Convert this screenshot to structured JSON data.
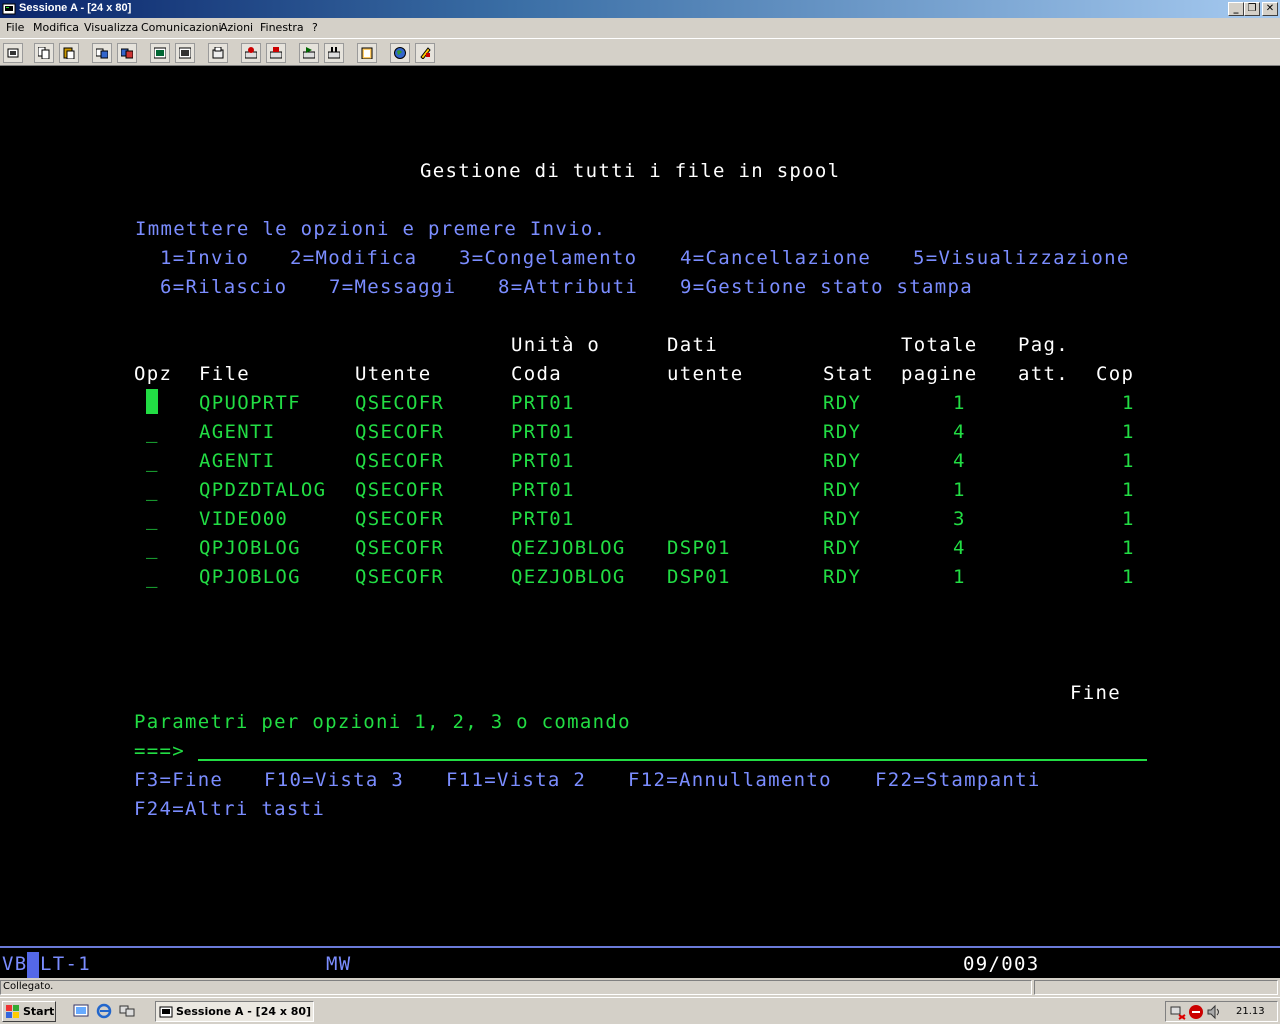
{
  "window": {
    "title": "Sessione A - [24 x 80]"
  },
  "menu": [
    "File",
    "Modifica",
    "Visualizza",
    "Comunicazioni",
    "Azioni",
    "Finestra",
    "?"
  ],
  "toolbar_icons": [
    "print-screen-icon",
    "copy-icon",
    "paste-icon",
    "send-icon",
    "receive-icon",
    "display-icon",
    "keypad-icon",
    "macro-icon",
    "record-icon",
    "stop-icon",
    "play-icon",
    "pause-icon",
    "clipboard-icon",
    "globe-icon",
    "tools-icon"
  ],
  "terminal": {
    "title": "Gestione di tutti i file in spool",
    "instructions": "Immettere le opzioni e premere Invio.",
    "options_row1": [
      "1=Invio",
      "2=Modifica",
      "3=Congelamento",
      "4=Cancellazione",
      "5=Visualizzazione"
    ],
    "options_row2": [
      "6=Rilascio",
      "7=Messaggi",
      "8=Attributi",
      "9=Gestione stato stampa"
    ],
    "headers_top": {
      "unit": "Unità o",
      "userdata": "Dati",
      "total": "Totale",
      "page": "Pag."
    },
    "headers": {
      "opt": "Opz",
      "file": "File",
      "user": "Utente",
      "queue": "Coda",
      "userdata": "utente",
      "status": "Stat",
      "pages": "pagine",
      "current": "att.",
      "copies": "Cop"
    },
    "rows": [
      {
        "opt": "",
        "file": "QPUOPRTF",
        "user": "QSECOFR",
        "queue": "PRT01",
        "userdata": "",
        "status": "RDY",
        "pages": "1",
        "copies": "1"
      },
      {
        "opt": "_",
        "file": "AGENTI",
        "user": "QSECOFR",
        "queue": "PRT01",
        "userdata": "",
        "status": "RDY",
        "pages": "4",
        "copies": "1"
      },
      {
        "opt": "_",
        "file": "AGENTI",
        "user": "QSECOFR",
        "queue": "PRT01",
        "userdata": "",
        "status": "RDY",
        "pages": "4",
        "copies": "1"
      },
      {
        "opt": "_",
        "file": "QPDZDTALOG",
        "user": "QSECOFR",
        "queue": "PRT01",
        "userdata": "",
        "status": "RDY",
        "pages": "1",
        "copies": "1"
      },
      {
        "opt": "_",
        "file": "VIDEO00",
        "user": "QSECOFR",
        "queue": "PRT01",
        "userdata": "",
        "status": "RDY",
        "pages": "3",
        "copies": "1"
      },
      {
        "opt": "_",
        "file": "QPJOBLOG",
        "user": "QSECOFR",
        "queue": "QEZJOBLOG",
        "userdata": "DSP01",
        "status": "RDY",
        "pages": "4",
        "copies": "1"
      },
      {
        "opt": "_",
        "file": "QPJOBLOG",
        "user": "QSECOFR",
        "queue": "QEZJOBLOG",
        "userdata": "DSP01",
        "status": "RDY",
        "pages": "1",
        "copies": "1"
      }
    ],
    "more": "Fine",
    "params_label": "Parametri per opzioni 1, 2, 3 o comando",
    "prompt": "===>",
    "command_value": "",
    "fkeys_row1": [
      "F3=Fine",
      "F10=Vista 3",
      "F11=Vista 2",
      "F12=Annullamento",
      "F22=Stampanti"
    ],
    "fkeys_row2": [
      "F24=Altri tasti"
    ]
  },
  "oia": {
    "left_a": "VB",
    "left_b": "LT-1",
    "mode": "MW",
    "position": "09/003"
  },
  "status": {
    "text": "Collegato."
  },
  "taskbar": {
    "start": "Start",
    "task": "Sessione A - [24 x 80]",
    "clock": "21.13"
  },
  "colors": {
    "terminal_bg": "#000000",
    "white": "#ffffff",
    "blue": "#7b8dff",
    "green": "#22dd44",
    "chrome": "#d4d0c8"
  }
}
